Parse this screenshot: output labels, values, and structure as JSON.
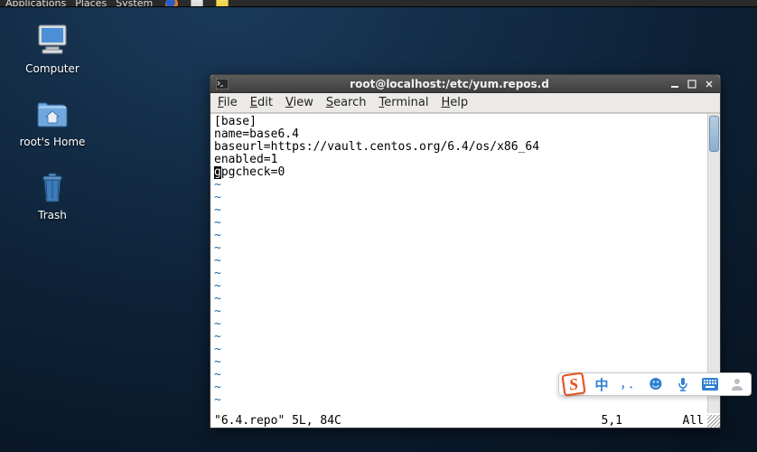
{
  "topbar": {
    "items": [
      "Applications",
      "Places",
      "System"
    ]
  },
  "desktop": {
    "items": [
      {
        "label": "Computer"
      },
      {
        "label": "root's Home"
      },
      {
        "label": "Trash"
      }
    ]
  },
  "window": {
    "title": "root@localhost:/etc/yum.repos.d",
    "menus": [
      {
        "key": "F",
        "rest": "ile"
      },
      {
        "key": "E",
        "rest": "dit"
      },
      {
        "key": "V",
        "rest": "iew"
      },
      {
        "key": "S",
        "rest": "earch"
      },
      {
        "key": "T",
        "rest": "erminal"
      },
      {
        "key": "H",
        "rest": "elp"
      }
    ],
    "content_lines": [
      "[base]",
      "name=base6.4",
      "baseurl=https://vault.centos.org/6.4/os/x86_64",
      "enabled=1"
    ],
    "cursor_char": "g",
    "cursor_line_rest": "pgcheck=0",
    "tilde_count": 18,
    "status": {
      "left": "\"6.4.repo\" 5L, 84C",
      "mid": "5,1",
      "right": "All"
    }
  },
  "ime": {
    "logo": "S",
    "lang": "中",
    "punct_full": "，",
    "punct_half": "．",
    "emoji": "☻",
    "mic": "🎤",
    "keyboard": "⌨",
    "person": "👤"
  }
}
